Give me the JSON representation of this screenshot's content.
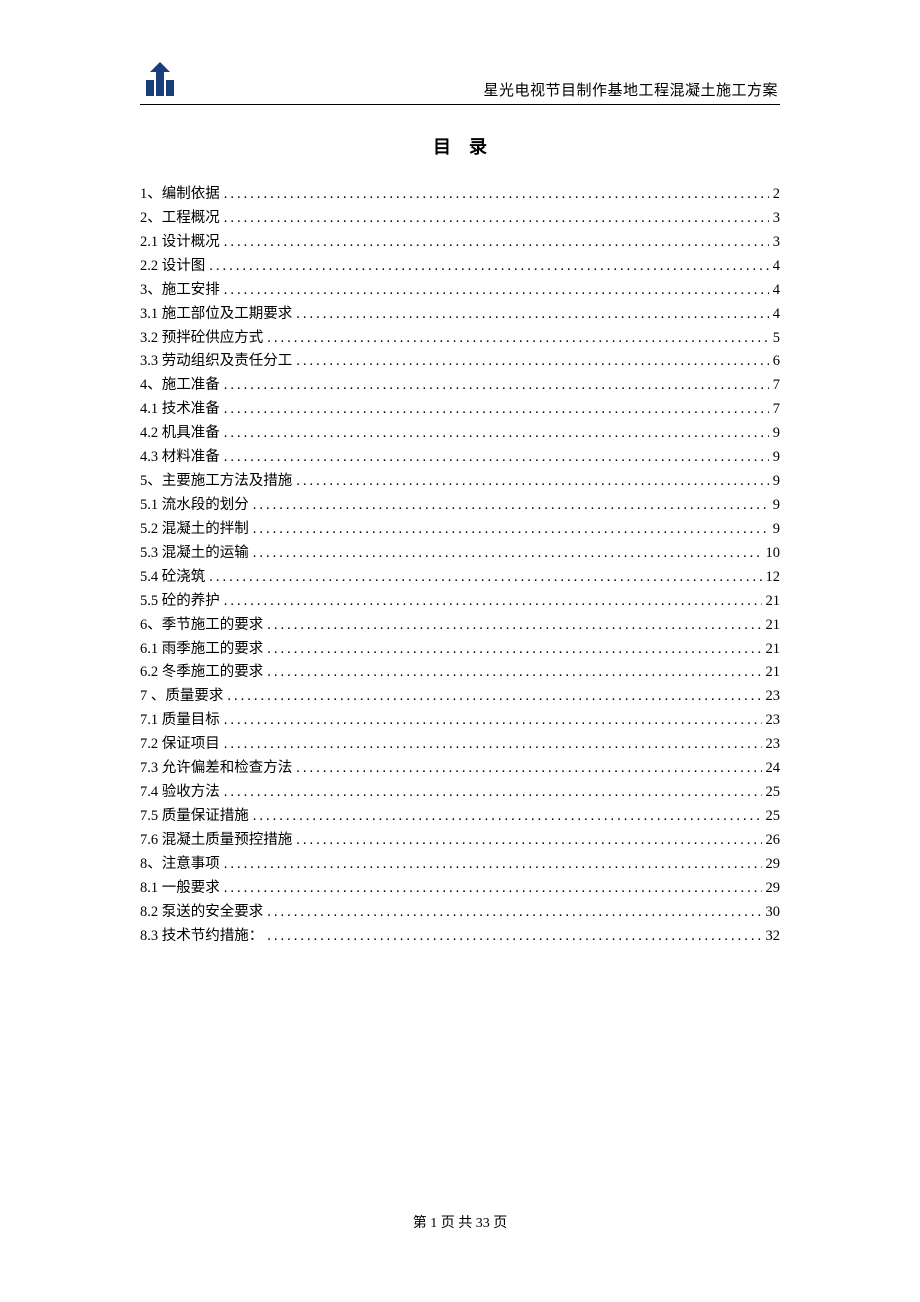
{
  "header": {
    "title": "星光电视节目制作基地工程混凝土施工方案"
  },
  "title_parts": {
    "a": "目",
    "b": "录"
  },
  "toc": [
    {
      "label": "1、编制依据",
      "page": "2"
    },
    {
      "label": "2、工程概况",
      "page": "3"
    },
    {
      "label": "2.1 设计概况",
      "page": "3"
    },
    {
      "label": "2.2 设计图",
      "page": "4"
    },
    {
      "label": "3、施工安排",
      "page": "4"
    },
    {
      "label": "3.1 施工部位及工期要求",
      "page": "4"
    },
    {
      "label": "3.2 预拌砼供应方式",
      "page": "5"
    },
    {
      "label": "3.3 劳动组织及责任分工",
      "page": "6"
    },
    {
      "label": "4、施工准备",
      "page": "7"
    },
    {
      "label": "4.1 技术准备",
      "page": "7"
    },
    {
      "label": "4.2 机具准备",
      "page": "9"
    },
    {
      "label": "4.3 材料准备",
      "page": "9"
    },
    {
      "label": "5、主要施工方法及措施",
      "page": "9"
    },
    {
      "label": "5.1 流水段的划分",
      "page": "9"
    },
    {
      "label": "5.2 混凝土的拌制",
      "page": "9"
    },
    {
      "label": "5.3 混凝土的运输",
      "page": "10"
    },
    {
      "label": "5.4 砼浇筑",
      "page": "12"
    },
    {
      "label": "5.5 砼的养护",
      "page": "21"
    },
    {
      "label": "6、季节施工的要求",
      "page": "21"
    },
    {
      "label": "6.1 雨季施工的要求",
      "page": "21"
    },
    {
      "label": "6.2 冬季施工的要求",
      "page": "21"
    },
    {
      "label": "7 、质量要求",
      "page": "23"
    },
    {
      "label": "7.1 质量目标",
      "page": "23"
    },
    {
      "label": "7.2 保证项目",
      "page": "23"
    },
    {
      "label": "7.3 允许偏差和检查方法",
      "page": "24"
    },
    {
      "label": "7.4 验收方法",
      "page": "25"
    },
    {
      "label": "7.5 质量保证措施",
      "page": "25"
    },
    {
      "label": "7.6 混凝土质量预控措施",
      "page": "26"
    },
    {
      "label": "8、注意事项",
      "page": "29"
    },
    {
      "label": "8.1 一般要求",
      "page": "29"
    },
    {
      "label": "8.2 泵送的安全要求",
      "page": "30"
    },
    {
      "label": "8.3 技术节约措施：",
      "page": "32"
    }
  ],
  "footer": {
    "prefix": "第",
    "current": "1",
    "mid": "页 共",
    "total": "33",
    "suffix": "页"
  }
}
